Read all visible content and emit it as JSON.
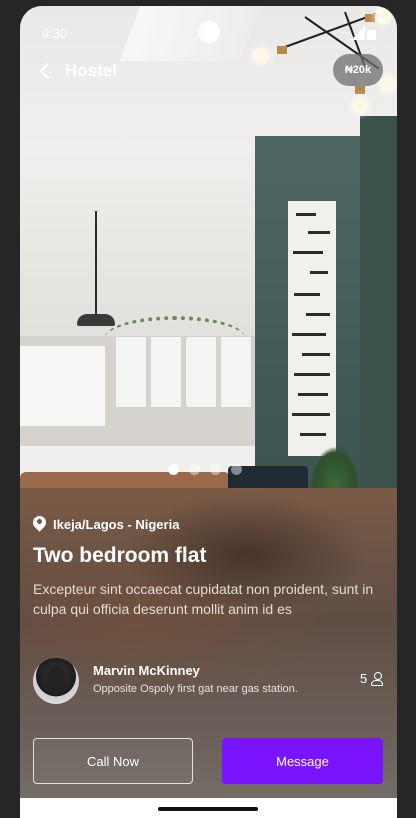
{
  "status_bar": {
    "time": "9:30"
  },
  "header": {
    "title": "Hostel",
    "price": "₦20k"
  },
  "gallery": {
    "dots": 4,
    "active_index": 0
  },
  "listing": {
    "location": "Ikeja/Lagos - Nigeria",
    "title": "Two bedroom flat",
    "description": "Excepteur sint occaecat cupidatat non proident, sunt in culpa qui officia deserunt mollit anim id es"
  },
  "host": {
    "name": "Marvin McKinney",
    "address": "Opposite Ospoly first gat near gas station.",
    "guests": "5"
  },
  "actions": {
    "call_label": "Call Now",
    "message_label": "Message"
  },
  "colors": {
    "primary": "#7a14ff",
    "background": "#262626"
  },
  "icons": [
    "back-arrow-icon",
    "location-pin-icon",
    "person-icon",
    "signal-icon",
    "battery-icon"
  ]
}
